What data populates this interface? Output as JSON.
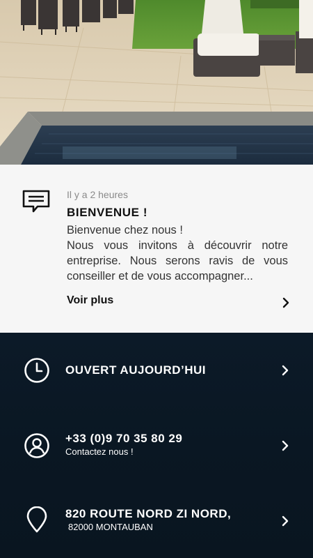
{
  "hero": {
    "icon": "pool-terrace-photo"
  },
  "news": {
    "icon": "message-icon",
    "time": "Il y a 2 heures",
    "title": "BIENVENUE !",
    "body_lines": [
      "Bienvenue chez nous !",
      "Nous vous invitons à découvrir notre entreprise. Nous serons ravis de vous conseiller et de vous accompagner..."
    ],
    "more_label": "Voir plus"
  },
  "info": {
    "hours": {
      "icon": "clock-icon",
      "title": "OUVERT AUJOURD’HUI"
    },
    "phone": {
      "icon": "user-icon",
      "title": "+33 (0)9 70 35 80 29",
      "subtitle": "Contactez nous !"
    },
    "address": {
      "icon": "location-pin-icon",
      "title": "820 ROUTE NORD ZI NORD,",
      "subtitle": "82000 MONTAUBAN"
    }
  },
  "colors": {
    "card_bg": "#f6f6f6",
    "info_bg": "#0b1826",
    "text_light": "#ffffff"
  }
}
